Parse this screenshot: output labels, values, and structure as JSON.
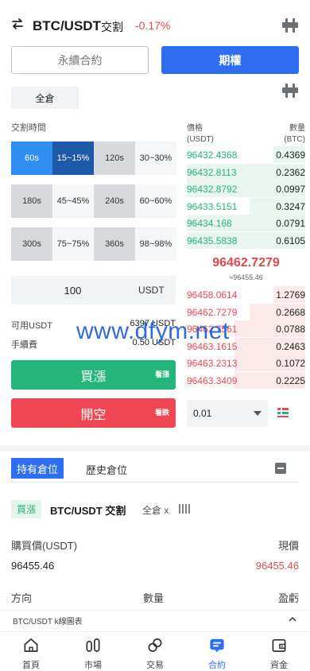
{
  "header": {
    "pair": "BTC/USDT",
    "type": "交割",
    "change": "-0.17%"
  },
  "tabs": {
    "perpetual": "永續合約",
    "options": "期權"
  },
  "cross_margin": "全倉",
  "period_label": "交割時間",
  "periods": [
    {
      "time": "60s",
      "rate": "15~15%"
    },
    {
      "time": "120s",
      "rate": "30~30%"
    },
    {
      "time": "180s",
      "rate": "45~45%"
    },
    {
      "time": "240s",
      "rate": "60~60%"
    },
    {
      "time": "300s",
      "rate": "75~75%"
    },
    {
      "time": "360s",
      "rate": "98~98%"
    }
  ],
  "amount": {
    "value": "100",
    "unit": "USDT"
  },
  "available": {
    "label": "可用USDT",
    "value": "6397 USDT"
  },
  "fee": {
    "label": "手續費",
    "value": "0.50 USDT"
  },
  "buttons": {
    "buy_up": "買漲",
    "buy_up_tag": "看漲",
    "open_short": "開空",
    "open_short_tag": "看跌"
  },
  "orderbook": {
    "price_header": "價格",
    "price_unit": "(USDT)",
    "qty_header": "數量",
    "qty_unit": "(BTC)",
    "bids": [
      {
        "price": "96432.4368",
        "qty": "0.4369",
        "depth": 0.27
      },
      {
        "price": "96432.8113",
        "qty": "0.2362",
        "depth": 1.0
      },
      {
        "price": "96432.8792",
        "qty": "0.0997",
        "depth": 1.0
      },
      {
        "price": "96433.5151",
        "qty": "0.3247",
        "depth": 0.47
      },
      {
        "price": "96434.168",
        "qty": "0.0791",
        "depth": 1.0
      },
      {
        "price": "96435.5838",
        "qty": "0.6105",
        "depth": 1.0
      }
    ],
    "last_price": "96462.7279",
    "index_price": "≈96455.46",
    "asks": [
      {
        "price": "96458.0614",
        "qty": "1.2769",
        "depth": 0.27
      },
      {
        "price": "96462.7279",
        "qty": "0.2668",
        "depth": 0.47
      },
      {
        "price": "96462.7561",
        "qty": "0.0788",
        "depth": 0.6
      },
      {
        "price": "96463.1615",
        "qty": "0.2463",
        "depth": 0.6
      },
      {
        "price": "96463.2313",
        "qty": "0.1072",
        "depth": 0.6
      },
      {
        "price": "96463.3409",
        "qty": "0.2225",
        "depth": 0.6
      }
    ]
  },
  "depth_select": "0.01",
  "positions": {
    "tab_current": "持有倉位",
    "tab_history": "歷史倉位",
    "side": "買漲",
    "pair": "BTC/USDT 交割",
    "margin": "全倉 x",
    "buy_price_label": "購買價(USDT)",
    "current_label": "現價",
    "buy_price": "96455.46",
    "current_price": "96455.46",
    "direction_label": "方向",
    "quantity_label": "數量",
    "pnl_label": "盈虧"
  },
  "kline_label": "BTC/USDT k線圖表",
  "watermark": "www.dfym.net",
  "nav": [
    {
      "label": "首頁",
      "icon": "home-icon"
    },
    {
      "label": "市場",
      "icon": "market-icon"
    },
    {
      "label": "交易",
      "icon": "trade-icon"
    },
    {
      "label": "合約",
      "icon": "contract-icon"
    },
    {
      "label": "資金",
      "icon": "wallet-icon"
    }
  ],
  "colors": {
    "accent": "#2e6ff2",
    "up": "#24b57b",
    "down": "#f04654"
  }
}
